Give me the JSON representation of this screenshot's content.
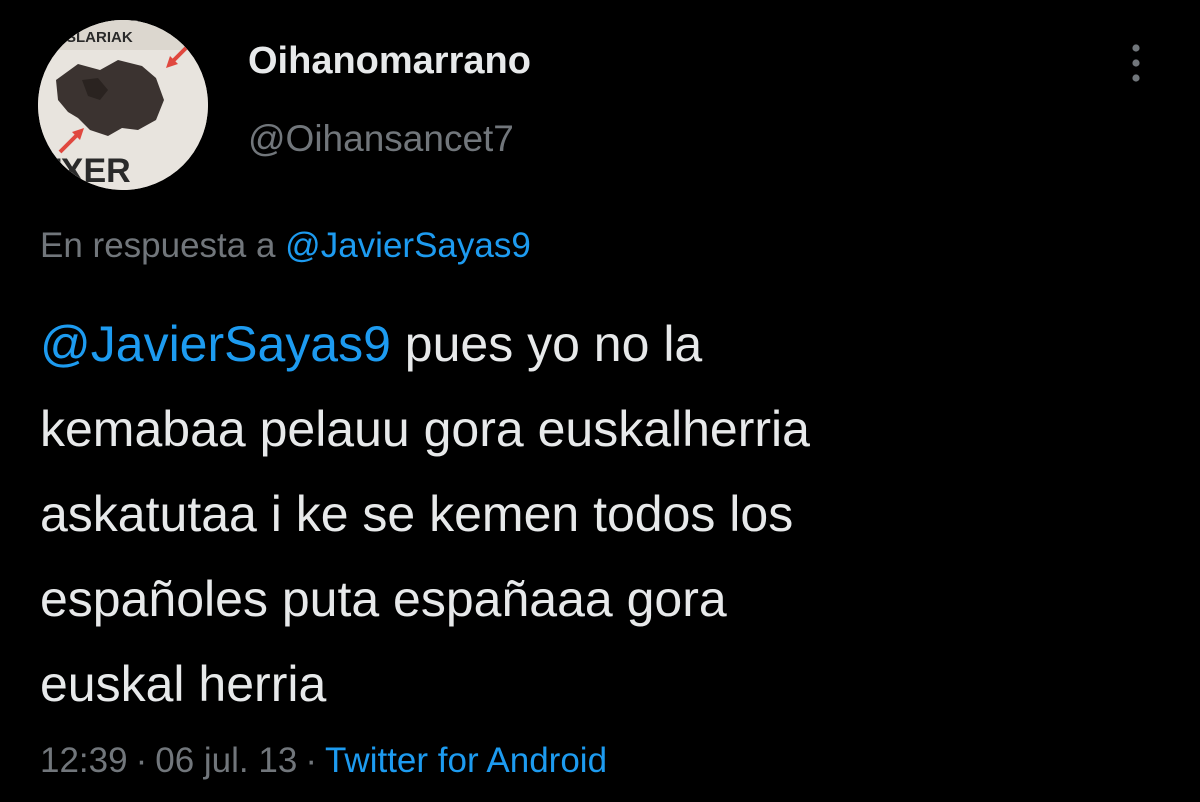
{
  "author": {
    "display_name": "Oihanomarrano",
    "handle": "@Oihansancet7",
    "avatar_text_top": "ESLARIAK",
    "avatar_text_bottom": "TXER"
  },
  "more_icon": "more-vertical-icon",
  "reply_context": {
    "prefix": "En respuesta a",
    "mention": "@JavierSayas9"
  },
  "tweet": {
    "mention": "@JavierSayas9",
    "line1_rest": " pues yo no la",
    "line2": "kemabaa pelauu gora euskalherria",
    "line3": "askatutaa i ke se kemen todos los",
    "line4": "españoles puta españaaa gora",
    "line5": "euskal herria"
  },
  "meta": {
    "time": "12:39",
    "separator": "·",
    "date": "06 jul. 13",
    "source": "Twitter for Android"
  },
  "colors": {
    "background": "#000000",
    "text": "#e7e9ea",
    "secondary": "#71767b",
    "link": "#1d9bf0"
  }
}
